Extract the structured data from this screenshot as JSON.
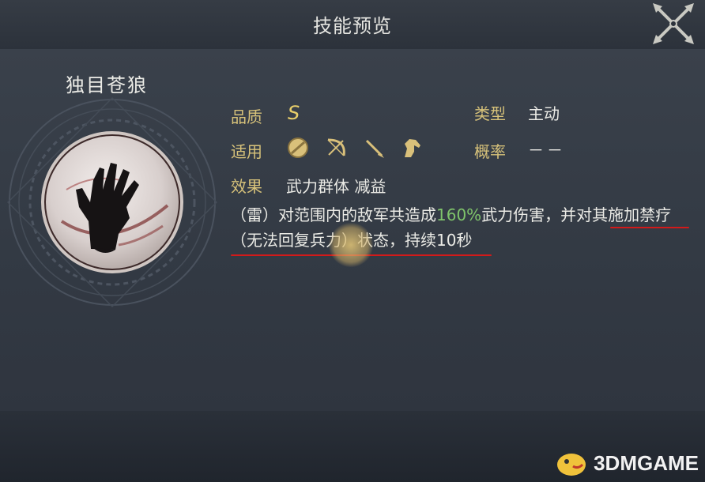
{
  "header": {
    "title": "技能预览"
  },
  "skill": {
    "name": "独目苍狼",
    "quality_label": "品质",
    "quality_value": "S",
    "type_label": "类型",
    "type_value": "主动",
    "applies_label": "适用",
    "applies_icons": [
      "shield-unit-icon",
      "bow-unit-icon",
      "spear-unit-icon",
      "cavalry-unit-icon"
    ],
    "rate_label": "概率",
    "rate_value": "－－",
    "effect_label": "效果",
    "effect_value": "武力群体 减益",
    "description": {
      "part1": "（雷）对范围内的敌军共造成",
      "highlight": "160%",
      "part2": "武力伤害，并对其施加禁疗（无法回复兵力）状态，持续10秒"
    }
  },
  "colors": {
    "label": "#d7c27a",
    "highlight": "#7fc46b",
    "underline": "#d21a1a"
  },
  "watermark": {
    "text": "3DMGAME"
  }
}
